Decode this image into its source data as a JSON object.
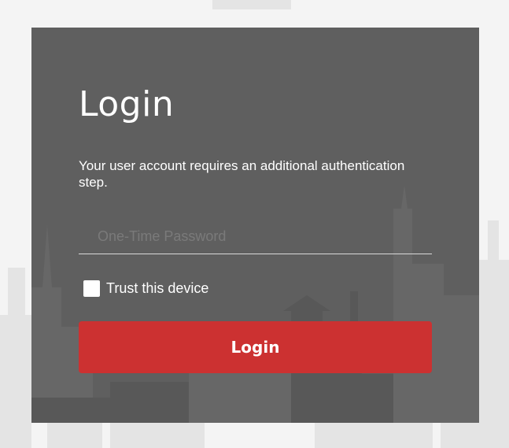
{
  "login": {
    "title": "Login",
    "message": "Your user account requires an additional authentication step.",
    "otp_placeholder": "One-Time Password",
    "trust_label": "Trust this device",
    "trust_checked": false,
    "button_label": "Login"
  },
  "colors": {
    "page_background": "#f4f4f4",
    "card_background": "#5f5f5f",
    "button_background": "#cc3131",
    "text": "#ffffff"
  }
}
